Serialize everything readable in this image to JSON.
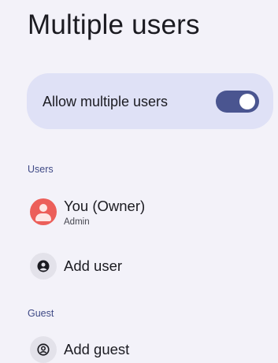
{
  "page": {
    "title": "Multiple users"
  },
  "toggle": {
    "label": "Allow multiple users",
    "enabled": true,
    "track_color": "#4a5590"
  },
  "users_section": {
    "header": "Users",
    "owner": {
      "name": "You (Owner)",
      "role": "Admin",
      "icon": "account-circle-icon",
      "avatar_color": "#ec5f5a"
    },
    "add_user": {
      "label": "Add user",
      "icon": "add-user-icon"
    }
  },
  "guest_section": {
    "header": "Guest",
    "add_guest": {
      "label": "Add guest",
      "icon": "add-guest-icon"
    }
  },
  "colors": {
    "background": "#f3f2f9",
    "card": "#dfe1f6",
    "section_header": "#3f4a86"
  }
}
